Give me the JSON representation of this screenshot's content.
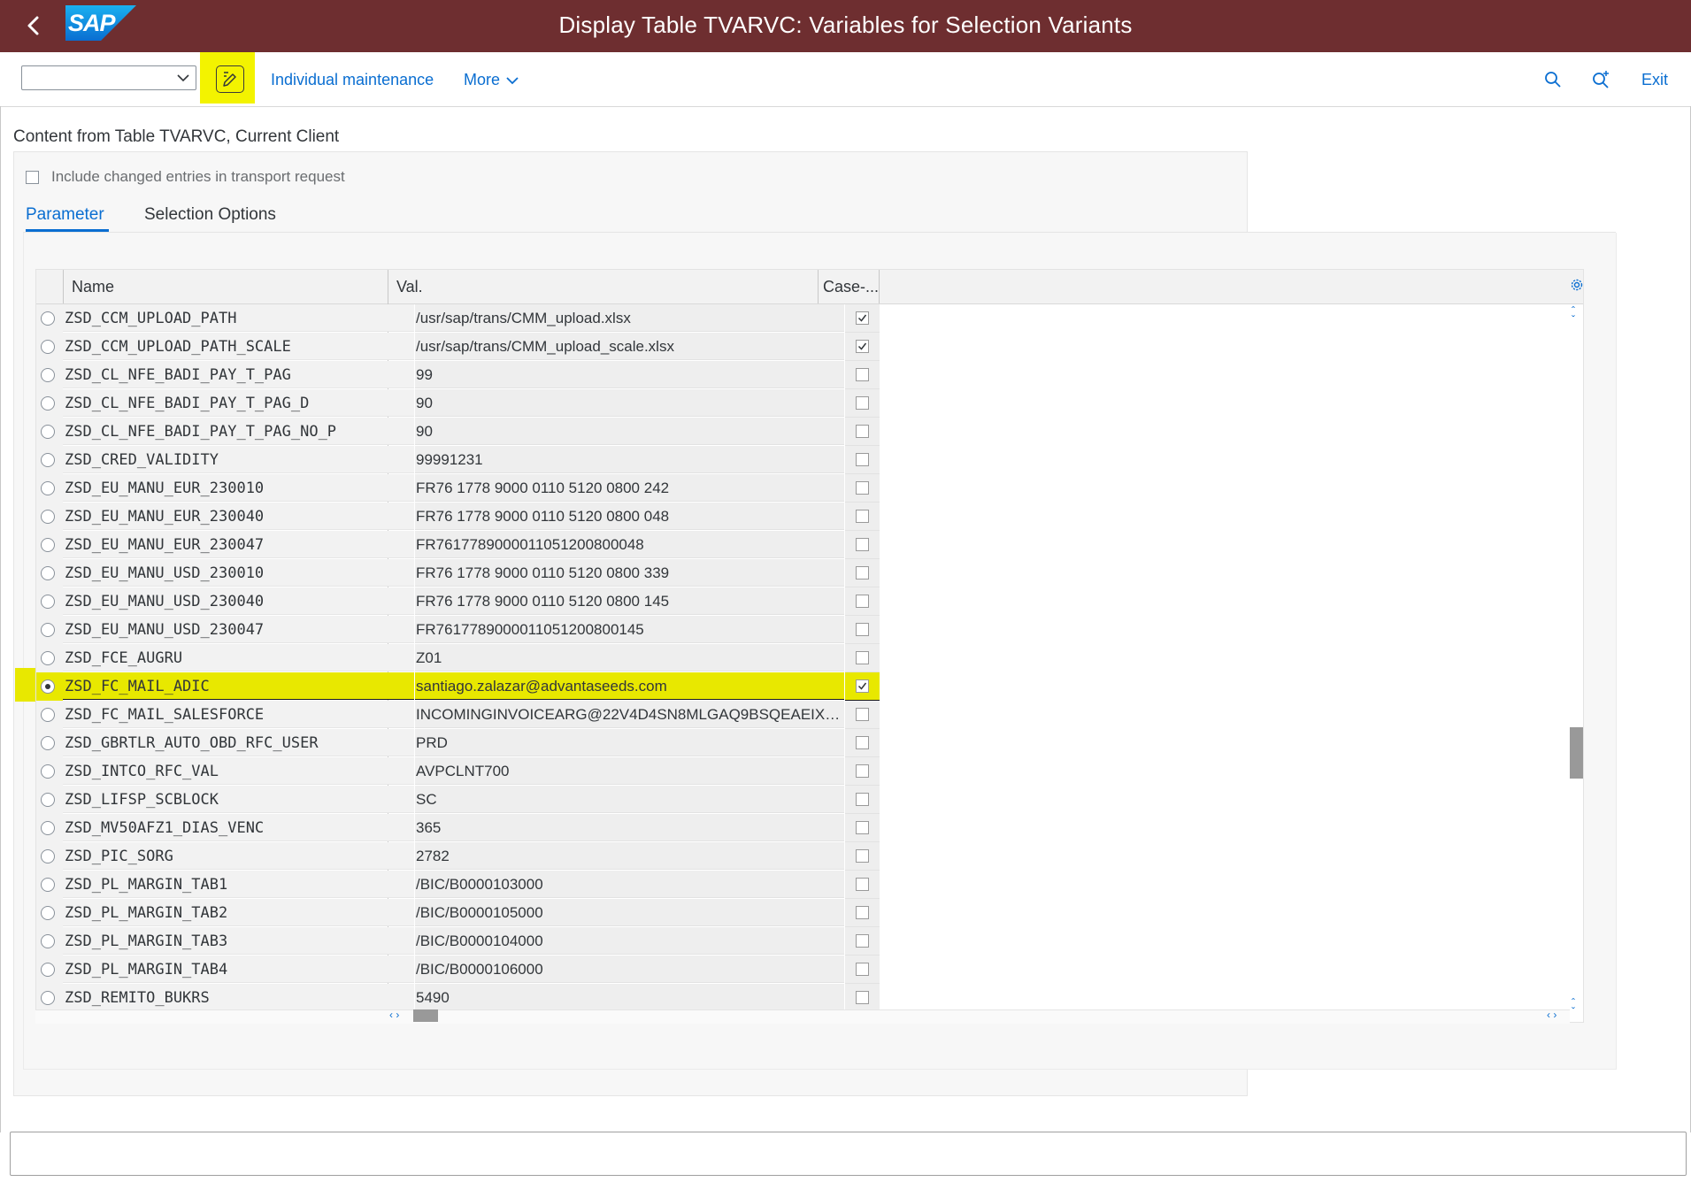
{
  "shell": {
    "title": "Display Table TVARVC: Variables for Selection Variants",
    "logo": "SAP",
    "background": "#6e2e30"
  },
  "toolbar": {
    "layout_select_value": "",
    "edit_icon": "display-change-icon",
    "individual_maintenance_label": "Individual maintenance",
    "more_label": "More",
    "exit_label": "Exit",
    "highlight_color": "#f3f300"
  },
  "content": {
    "title": "Content from Table TVARVC, Current Client",
    "transport_checkbox_label": "Include changed entries in transport request",
    "tabs": [
      "Parameter",
      "Selection Options"
    ],
    "active_tab": "Parameter"
  },
  "grid": {
    "columns": [
      "Name",
      "Val.",
      "Case-..."
    ],
    "rows": [
      {
        "name": "ZSD_CCM_UPLOAD_PATH",
        "val": "/usr/sap/trans/CMM_upload.xlsx",
        "case": true
      },
      {
        "name": "ZSD_CCM_UPLOAD_PATH_SCALE",
        "val": "/usr/sap/trans/CMM_upload_scale.xlsx",
        "case": true
      },
      {
        "name": "ZSD_CL_NFE_BADI_PAY_T_PAG",
        "val": "99",
        "case": false
      },
      {
        "name": "ZSD_CL_NFE_BADI_PAY_T_PAG_D",
        "val": "90",
        "case": false
      },
      {
        "name": "ZSD_CL_NFE_BADI_PAY_T_PAG_NO_P",
        "val": "90",
        "case": false
      },
      {
        "name": "ZSD_CRED_VALIDITY",
        "val": "99991231",
        "case": false
      },
      {
        "name": "ZSD_EU_MANU_EUR_230010",
        "val": "FR76 1778 9000 0110 5120 0800 242",
        "case": false
      },
      {
        "name": "ZSD_EU_MANU_EUR_230040",
        "val": "FR76 1778 9000 0110 5120 0800 048",
        "case": false
      },
      {
        "name": "ZSD_EU_MANU_EUR_230047",
        "val": "FR7617789000011051200800048",
        "case": false
      },
      {
        "name": "ZSD_EU_MANU_USD_230010",
        "val": "FR76 1778 9000 0110 5120 0800 339",
        "case": false
      },
      {
        "name": "ZSD_EU_MANU_USD_230040",
        "val": "FR76 1778 9000 0110 5120 0800 145",
        "case": false
      },
      {
        "name": "ZSD_EU_MANU_USD_230047",
        "val": "FR7617789000011051200800145",
        "case": false
      },
      {
        "name": "ZSD_FCE_AUGRU",
        "val": "Z01",
        "case": false
      },
      {
        "name": "ZSD_FC_MAIL_ADIC",
        "val": "santiago.zalazar@advantaseeds.com",
        "case": true,
        "selected": true
      },
      {
        "name": "ZSD_FC_MAIL_SALESFORCE",
        "val": "INCOMINGINVOICEARG@22V4D4SN8MLGAQ9BSQEAEIXT...",
        "case": false
      },
      {
        "name": "ZSD_GBRTLR_AUTO_OBD_RFC_USER",
        "val": "PRD",
        "case": false
      },
      {
        "name": "ZSD_INTCO_RFC_VAL",
        "val": "AVPCLNT700",
        "case": false
      },
      {
        "name": "ZSD_LIFSP_SCBLOCK",
        "val": "SC",
        "case": false
      },
      {
        "name": "ZSD_MV50AFZ1_DIAS_VENC",
        "val": "365",
        "case": false
      },
      {
        "name": "ZSD_PIC_SORG",
        "val": "2782",
        "case": false
      },
      {
        "name": "ZSD_PL_MARGIN_TAB1",
        "val": "/BIC/B0000103000",
        "case": false
      },
      {
        "name": "ZSD_PL_MARGIN_TAB2",
        "val": "/BIC/B0000105000",
        "case": false
      },
      {
        "name": "ZSD_PL_MARGIN_TAB3",
        "val": "/BIC/B0000104000",
        "case": false
      },
      {
        "name": "ZSD_PL_MARGIN_TAB4",
        "val": "/BIC/B0000106000",
        "case": false
      },
      {
        "name": "ZSD_REMITO_BUKRS",
        "val": "5490",
        "case": false
      }
    ]
  },
  "status_bar": {
    "message": ""
  }
}
